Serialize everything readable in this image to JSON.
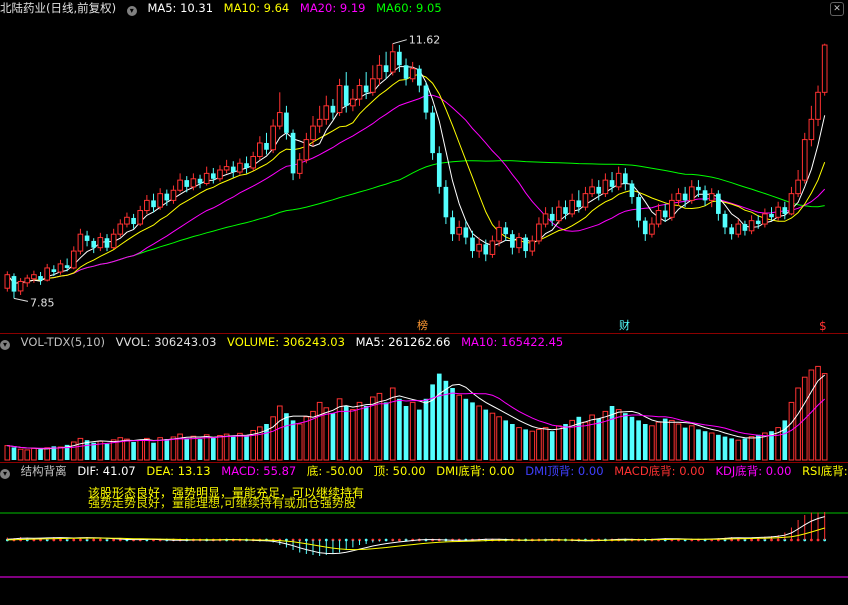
{
  "header": {
    "stock_name": "北陆药业",
    "period": "(日线,前复权)",
    "ma5": "MA5: 10.31",
    "ma10": "MA10: 9.64",
    "ma20": "MA20: 9.19",
    "ma60": "MA60: 9.05"
  },
  "volume_header": {
    "indicator": "VOL-TDX(5,10)",
    "vvol": "VVOL: 306243.03",
    "volume": "VOLUME: 306243.03",
    "ma5": "MA5: 261262.66",
    "ma10": "MA10: 165422.45"
  },
  "macd_header": {
    "indicator": "结构背离",
    "dif": "DIF: 41.07",
    "dea": "DEA: 13.13",
    "macd": "MACD: 55.87",
    "bottom": "底: -50.00",
    "top": "顶: 50.00",
    "dmi_bottom": "DMI底背: 0.00",
    "dmi_div": "DMI顶背: 0.00",
    "macd_bottom": "MACD底背: 0.00",
    "kdj_bottom": "KDJ底背: 0.00",
    "rsi_bottom": "RSI底背: 0."
  },
  "notes": {
    "line1": "该股形态良好，强势明显，量能充足，可以继续持有",
    "line2": "强势走势良好，量能理想,可继续持有或加仓强势股"
  },
  "colors": {
    "candle_up": "#ff3232",
    "candle_down": "#54ffff",
    "ma5": "#ffffff",
    "ma10": "#ffff00",
    "ma20": "#ff00ff",
    "ma60": "#00ff00",
    "separator": "#8b0000",
    "dea": "#ffff00",
    "macd_up": "#ff3232",
    "macd_down": "#54ffff",
    "axis_text": "#c0c0c0"
  },
  "markers": {
    "bang": "榜",
    "cai": "财",
    "dollar": "$"
  },
  "chart_data": [
    {
      "type": "candlestick",
      "title": "北陆药业 (日线,前复权)",
      "ylim": [
        7.5,
        12.0
      ],
      "price_labels": {
        "high": "11.62",
        "low": "7.85"
      },
      "candles": [
        [
          8.0,
          8.2,
          8.25,
          7.95
        ],
        [
          8.18,
          7.95,
          8.22,
          7.85
        ],
        [
          7.96,
          8.1,
          8.15,
          7.9
        ],
        [
          8.08,
          8.15,
          8.2,
          8.02
        ],
        [
          8.14,
          8.2,
          8.26,
          8.08
        ],
        [
          8.18,
          8.12,
          8.24,
          8.05
        ],
        [
          8.12,
          8.3,
          8.36,
          8.1
        ],
        [
          8.28,
          8.24,
          8.34,
          8.18
        ],
        [
          8.24,
          8.36,
          8.42,
          8.2
        ],
        [
          8.34,
          8.3,
          8.44,
          8.25
        ],
        [
          8.3,
          8.55,
          8.62,
          8.28
        ],
        [
          8.55,
          8.8,
          8.88,
          8.5
        ],
        [
          8.78,
          8.7,
          8.85,
          8.62
        ],
        [
          8.7,
          8.6,
          8.74,
          8.52
        ],
        [
          8.6,
          8.75,
          8.82,
          8.55
        ],
        [
          8.74,
          8.6,
          8.8,
          8.55
        ],
        [
          8.6,
          8.8,
          8.88,
          8.58
        ],
        [
          8.8,
          8.95,
          9.02,
          8.76
        ],
        [
          8.95,
          9.05,
          9.12,
          8.9
        ],
        [
          9.04,
          8.95,
          9.1,
          8.88
        ],
        [
          8.95,
          9.15,
          9.22,
          8.92
        ],
        [
          9.15,
          9.3,
          9.38,
          9.1
        ],
        [
          9.3,
          9.2,
          9.4,
          9.12
        ],
        [
          9.2,
          9.4,
          9.48,
          9.16
        ],
        [
          9.4,
          9.3,
          9.46,
          9.22
        ],
        [
          9.3,
          9.45,
          9.52,
          9.25
        ],
        [
          9.45,
          9.6,
          9.7,
          9.42
        ],
        [
          9.6,
          9.5,
          9.66,
          9.42
        ],
        [
          9.5,
          9.62,
          9.7,
          9.45
        ],
        [
          9.62,
          9.55,
          9.68,
          9.48
        ],
        [
          9.55,
          9.7,
          9.8,
          9.52
        ],
        [
          9.7,
          9.62,
          9.78,
          9.55
        ],
        [
          9.62,
          9.75,
          9.82,
          9.58
        ],
        [
          9.75,
          9.8,
          9.9,
          9.7
        ],
        [
          9.8,
          9.72,
          9.88,
          9.64
        ],
        [
          9.72,
          9.85,
          9.92,
          9.68
        ],
        [
          9.85,
          9.78,
          9.95,
          9.7
        ],
        [
          9.78,
          9.95,
          10.02,
          9.74
        ],
        [
          9.95,
          10.15,
          10.25,
          9.9
        ],
        [
          10.15,
          10.05,
          10.3,
          9.98
        ],
        [
          10.05,
          10.4,
          10.5,
          10.0
        ],
        [
          10.4,
          10.6,
          10.9,
          10.35
        ],
        [
          10.6,
          10.3,
          10.7,
          10.2
        ],
        [
          10.3,
          9.7,
          10.35,
          9.6
        ],
        [
          9.7,
          9.9,
          10.0,
          9.62
        ],
        [
          9.9,
          10.2,
          10.3,
          9.85
        ],
        [
          10.2,
          10.4,
          10.55,
          10.1
        ],
        [
          10.4,
          10.5,
          10.7,
          10.3
        ],
        [
          10.5,
          10.7,
          10.85,
          10.42
        ],
        [
          10.7,
          10.6,
          10.8,
          10.5
        ],
        [
          10.6,
          11.0,
          11.1,
          10.55
        ],
        [
          11.0,
          10.7,
          11.2,
          10.6
        ],
        [
          10.7,
          10.8,
          10.95,
          10.62
        ],
        [
          10.8,
          11.0,
          11.1,
          10.7
        ],
        [
          11.0,
          10.9,
          11.2,
          10.8
        ],
        [
          10.9,
          11.1,
          11.3,
          10.85
        ],
        [
          11.1,
          11.3,
          11.45,
          11.0
        ],
        [
          11.3,
          11.2,
          11.5,
          11.1
        ],
        [
          11.2,
          11.5,
          11.62,
          11.15
        ],
        [
          11.5,
          11.3,
          11.6,
          11.2
        ],
        [
          11.3,
          11.1,
          11.4,
          11.0
        ],
        [
          11.1,
          11.25,
          11.35,
          11.05
        ],
        [
          11.25,
          11.0,
          11.3,
          10.9
        ],
        [
          11.0,
          10.6,
          11.05,
          10.5
        ],
        [
          10.6,
          10.0,
          10.7,
          9.9
        ],
        [
          10.0,
          9.5,
          10.1,
          9.4
        ],
        [
          9.5,
          9.05,
          9.6,
          8.95
        ],
        [
          9.05,
          8.8,
          9.15,
          8.7
        ],
        [
          8.8,
          8.9,
          9.0,
          8.7
        ],
        [
          8.9,
          8.75,
          9.0,
          8.65
        ],
        [
          8.75,
          8.55,
          8.85,
          8.45
        ],
        [
          8.55,
          8.65,
          8.75,
          8.45
        ],
        [
          8.65,
          8.5,
          8.72,
          8.4
        ],
        [
          8.5,
          8.7,
          8.78,
          8.45
        ],
        [
          8.7,
          8.9,
          9.0,
          8.62
        ],
        [
          8.9,
          8.8,
          8.98,
          8.7
        ],
        [
          8.8,
          8.6,
          8.86,
          8.5
        ],
        [
          8.6,
          8.75,
          8.82,
          8.52
        ],
        [
          8.75,
          8.55,
          8.8,
          8.45
        ],
        [
          8.55,
          8.7,
          8.78,
          8.48
        ],
        [
          8.7,
          8.95,
          9.05,
          8.65
        ],
        [
          8.95,
          9.1,
          9.2,
          8.9
        ],
        [
          9.1,
          9.0,
          9.2,
          8.92
        ],
        [
          9.0,
          9.2,
          9.3,
          8.95
        ],
        [
          9.2,
          9.1,
          9.3,
          9.02
        ],
        [
          9.1,
          9.3,
          9.4,
          9.05
        ],
        [
          9.3,
          9.2,
          9.45,
          9.12
        ],
        [
          9.2,
          9.4,
          9.5,
          9.15
        ],
        [
          9.4,
          9.5,
          9.62,
          9.35
        ],
        [
          9.5,
          9.4,
          9.6,
          9.3
        ],
        [
          9.4,
          9.6,
          9.7,
          9.35
        ],
        [
          9.6,
          9.5,
          9.72,
          9.42
        ],
        [
          9.5,
          9.7,
          9.8,
          9.45
        ],
        [
          9.7,
          9.55,
          9.78,
          9.45
        ],
        [
          9.55,
          9.35,
          9.6,
          9.25
        ],
        [
          9.35,
          9.0,
          9.4,
          8.9
        ],
        [
          9.0,
          8.8,
          9.05,
          8.7
        ],
        [
          8.8,
          8.95,
          9.05,
          8.75
        ],
        [
          8.95,
          9.15,
          9.25,
          8.9
        ],
        [
          9.15,
          9.05,
          9.25,
          8.98
        ],
        [
          9.05,
          9.3,
          9.4,
          9.0
        ],
        [
          9.3,
          9.4,
          9.48,
          9.22
        ],
        [
          9.4,
          9.3,
          9.5,
          9.2
        ],
        [
          9.3,
          9.5,
          9.6,
          9.25
        ],
        [
          9.5,
          9.45,
          9.6,
          9.35
        ],
        [
          9.45,
          9.3,
          9.52,
          9.22
        ],
        [
          9.3,
          9.4,
          9.48,
          9.2
        ],
        [
          9.4,
          9.1,
          9.45,
          9.0
        ],
        [
          9.1,
          8.9,
          9.15,
          8.8
        ],
        [
          8.9,
          8.8,
          8.95,
          8.72
        ],
        [
          8.8,
          8.95,
          9.02,
          8.75
        ],
        [
          8.95,
          8.85,
          9.0,
          8.78
        ],
        [
          8.85,
          9.0,
          9.08,
          8.8
        ],
        [
          9.0,
          8.95,
          9.08,
          8.88
        ],
        [
          8.95,
          9.1,
          9.18,
          8.9
        ],
        [
          9.1,
          9.05,
          9.2,
          9.0
        ],
        [
          9.05,
          9.2,
          9.28,
          9.0
        ],
        [
          9.2,
          9.1,
          9.28,
          9.02
        ],
        [
          9.1,
          9.4,
          9.5,
          9.08
        ],
        [
          9.4,
          9.6,
          9.75,
          9.35
        ],
        [
          9.6,
          10.2,
          10.3,
          9.55
        ],
        [
          10.2,
          10.5,
          10.7,
          10.1
        ],
        [
          10.5,
          10.9,
          11.0,
          10.4
        ],
        [
          10.9,
          11.6,
          11.62,
          10.85
        ]
      ]
    },
    {
      "type": "bar",
      "title": "VOL-TDX(5,10)",
      "values": [
        40,
        35,
        30,
        28,
        32,
        30,
        34,
        38,
        36,
        42,
        50,
        60,
        55,
        48,
        52,
        45,
        56,
        62,
        58,
        50,
        55,
        60,
        48,
        62,
        58,
        64,
        72,
        60,
        66,
        58,
        70,
        62,
        68,
        72,
        65,
        74,
        66,
        82,
        92,
        100,
        120,
        150,
        130,
        110,
        100,
        120,
        135,
        160,
        145,
        130,
        170,
        150,
        140,
        160,
        150,
        175,
        185,
        160,
        200,
        170,
        150,
        160,
        140,
        170,
        210,
        240,
        220,
        200,
        180,
        170,
        160,
        150,
        140,
        130,
        120,
        110,
        100,
        90,
        85,
        80,
        85,
        90,
        80,
        95,
        100,
        110,
        120,
        105,
        125,
        115,
        135,
        150,
        140,
        130,
        120,
        110,
        100,
        95,
        105,
        115,
        110,
        100,
        90,
        95,
        85,
        80,
        75,
        70,
        65,
        60,
        55,
        60,
        65,
        70,
        75,
        80,
        90,
        110,
        160,
        200,
        230,
        250,
        260,
        240
      ],
      "ylim": [
        0,
        300
      ]
    },
    {
      "type": "bar",
      "title": "结构背离",
      "values": [
        5,
        4,
        6,
        5,
        3,
        4,
        5,
        6,
        5,
        4,
        3,
        5,
        6,
        4,
        3,
        2,
        1,
        0,
        -1,
        0,
        1,
        2,
        1,
        0,
        -1,
        -2,
        -1,
        0,
        1,
        0,
        -1,
        0,
        1,
        2,
        1,
        0,
        -1,
        -2,
        -3,
        -2,
        -5,
        -10,
        -15,
        -20,
        -25,
        -28,
        -30,
        -32,
        -30,
        -28,
        -25,
        -20,
        -15,
        -10,
        -8,
        -5,
        -3,
        -2,
        -1,
        0,
        1,
        2,
        3,
        2,
        1,
        0,
        -1,
        -2,
        -1,
        0,
        1,
        2,
        3,
        2,
        1,
        0,
        -1,
        -2,
        -1,
        0,
        1,
        2,
        1,
        0,
        -1,
        -2,
        -3,
        -2,
        -1,
        0,
        1,
        2,
        3,
        2,
        1,
        0,
        1,
        2,
        3,
        4,
        3,
        2,
        1,
        0,
        1,
        2,
        3,
        4,
        5,
        6,
        5,
        4,
        5,
        6,
        7,
        8,
        10,
        15,
        25,
        40,
        50,
        55,
        55,
        56
      ],
      "ylim": [
        -60,
        60
      ]
    }
  ]
}
